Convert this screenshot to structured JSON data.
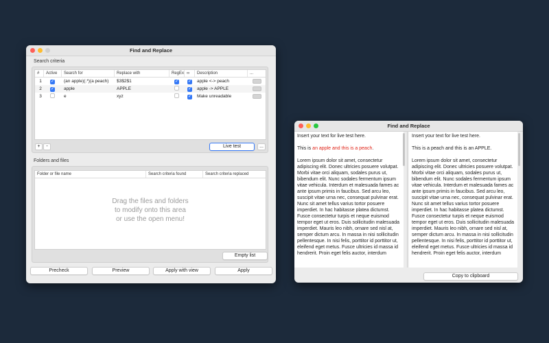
{
  "main_window": {
    "title": "Find and Replace",
    "search_section_label": "Search criteria",
    "columns": [
      "#",
      "Active",
      "Search for",
      "Replace with",
      "RegEx",
      "∞",
      "Description",
      "..."
    ],
    "rows": [
      {
        "num": "1",
        "active": true,
        "search": "(an apple)(.*)(a peach)",
        "replace": "$3$2$1",
        "regex": true,
        "multi": true,
        "description": "apple <-> peach"
      },
      {
        "num": "2",
        "active": true,
        "search": "apple",
        "replace": "APPLE",
        "regex": false,
        "multi": true,
        "description": "apple -> APPLE"
      },
      {
        "num": "3",
        "active": false,
        "search": "e",
        "replace": "xyz",
        "regex": false,
        "multi": true,
        "description": "Make unreadable"
      }
    ],
    "add_label": "+",
    "remove_label": "-",
    "live_test_label": "Live test",
    "more_label": "...",
    "folders_section_label": "Folders and files",
    "file_columns": [
      "Folder or file name",
      "Search criteria found",
      "Search criteria replaced"
    ],
    "drop_text_line1": "Drag the files and folders",
    "drop_text_line2": "to modify onto this area",
    "drop_text_line3": "or use the open menu!",
    "empty_list_label": "Empty list",
    "buttons": {
      "precheck": "Precheck",
      "preview": "Preview",
      "apply_with_view": "Apply with view",
      "apply": "Apply"
    }
  },
  "live_window": {
    "title": "Find and Replace",
    "left": {
      "line1": "Insert your text for live test here.",
      "line2_pre": "This is ",
      "line2_hl": "an apple and this is a peach",
      "line2_post": ".",
      "lorem": "Lorem ipsum dolor sit amet, consectetur adipiscing elit. Donec ultricies posuere volutpat. Morbi vitae orci aliquam, sodales purus ut, bibendum elit. Nunc sodales fermentum ipsum vitae vehicula. Interdum et malesuada fames ac ante ipsum primis in faucibus. Sed arcu leo, suscipit vitae urna nec, consequat pulvinar erat. Nunc sit amet tellus varius tortor posuere imperdiet. In hac habitasse platea dictumst. Fusce consectetur turpis et neque euismod tempor eget ut eros. Duis sollicitudin malesuada imperdiet. Mauris leo nibh, ornare sed nisl at, semper dictum arcu. In massa in nisi sollicitudin pellentesque. In nisi felis, porttitor id porttitor ut, eleifend eget metus. Fusce ultricies id massa id hendrerit. Proin eget felis auctor, interdum"
    },
    "right": {
      "line1": "Insert your text for live test here.",
      "line2": "This is a peach and this is an APPLE.",
      "lorem": "Lorem ipsum dolor sit amet, consectetur adipiscing elit. Donec ultricies posuere volutpat. Morbi vitae orci aliquam, sodales purus ut, bibendum elit. Nunc sodales fermentum ipsum vitae vehicula. Interdum et malesuada fames ac ante ipsum primis in faucibus. Sed arcu leo, suscipit vitae urna nec, consequat pulvinar erat. Nunc sit amet tellus varius tortor posuere imperdiet. In hac habitasse platea dictumst. Fusce consectetur turpis et neque euismod tempor eget ut eros. Duis sollicitudin malesuada imperdiet. Mauris leo nibh, ornare sed nisl at, semper dictum arcu. In massa in nisi sollicitudin pellentesque. In nisi felis, porttitor id porttitor ut, eleifend eget metus. Fusce ultricies id massa id hendrerit. Proin eget felis auctor, interdum"
    },
    "copy_label": "Copy to clipboard"
  },
  "colors": {
    "desktop": "#1c2a3b",
    "accent": "#3478f6",
    "highlight": "#e0261a"
  }
}
